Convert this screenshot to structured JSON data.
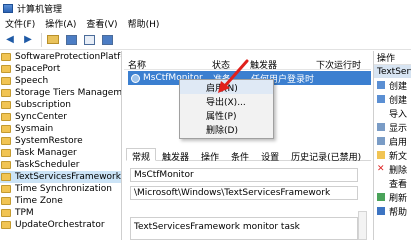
{
  "window": {
    "title": "计算机管理"
  },
  "menu": [
    "文件(F)",
    "操作(A)",
    "查看(V)",
    "帮助(H)"
  ],
  "toolbar": {
    "back": "◀",
    "forward": "▶"
  },
  "tree": {
    "items": [
      "SoftwareProtectionPlatform",
      "SpacePort",
      "Speech",
      "Storage Tiers Management",
      "Subscription",
      "SyncCenter",
      "Sysmain",
      "SystemRestore",
      "Task Manager",
      "TaskScheduler",
      "TextServicesFramework",
      "Time Synchronization",
      "Time Zone",
      "TPM",
      "UpdateOrchestrator"
    ],
    "selected_index": 10
  },
  "task_list": {
    "headers": [
      "名称",
      "状态",
      "触发器",
      "下次运行时"
    ],
    "row": {
      "name": "MsCtfMonitor",
      "status": "准备",
      "trigger": "任何用户登录时"
    }
  },
  "context_menu": {
    "items": [
      "启用(N)",
      "导出(X)...",
      "属性(P)",
      "删除(D)"
    ]
  },
  "details": {
    "tabs": [
      "常规",
      "触发器",
      "操作",
      "条件",
      "设置",
      "历史记录(已禁用)"
    ],
    "name_value": "MsCtfMonitor",
    "path_value": "\\Microsoft\\Windows\\TextServicesFramework",
    "description_value": "TextServicesFramework monitor task"
  },
  "actions": {
    "header": "操作",
    "section": "TextServ",
    "items": [
      "创建",
      "创建",
      "导入",
      "显示",
      "启用",
      "新文",
      "删除",
      "查看",
      "刷新",
      "帮助"
    ]
  },
  "colors": {
    "selection": "#3b7fd0",
    "tree_selected": "#cce4f7",
    "arrow": "#e0201b"
  }
}
